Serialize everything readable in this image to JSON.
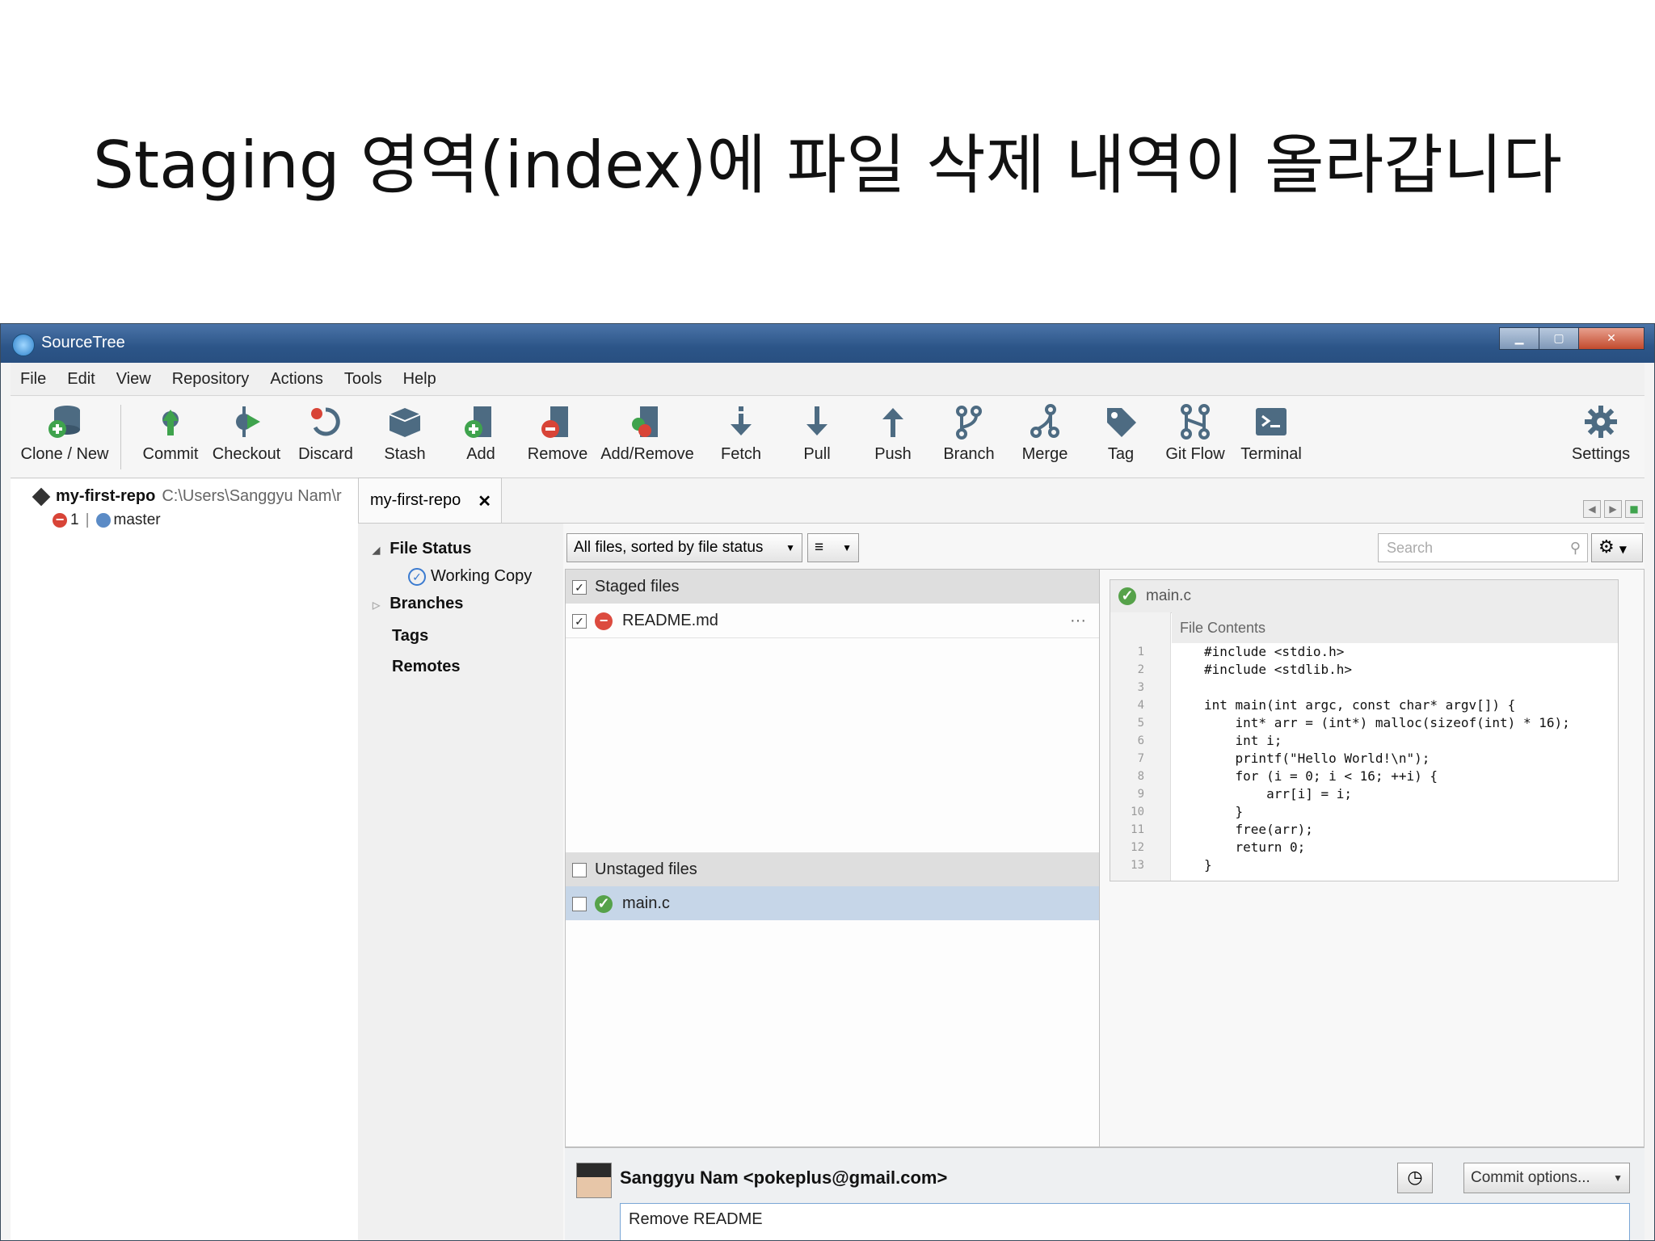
{
  "slide": {
    "title": "Staging 영역(index)에 파일 삭제 내역이 올라갑니다"
  },
  "window": {
    "title": "SourceTree",
    "controls": {
      "minimize": "▁",
      "maximize": "▢",
      "close": "✕"
    }
  },
  "menu": [
    "File",
    "Edit",
    "View",
    "Repository",
    "Actions",
    "Tools",
    "Help"
  ],
  "toolbar": {
    "clone_new": "Clone / New",
    "commit": "Commit",
    "checkout": "Checkout",
    "discard": "Discard",
    "stash": "Stash",
    "add": "Add",
    "remove": "Remove",
    "add_remove": "Add/Remove",
    "fetch": "Fetch",
    "pull": "Pull",
    "push": "Push",
    "branch": "Branch",
    "merge": "Merge",
    "tag": "Tag",
    "git_flow": "Git Flow",
    "terminal": "Terminal",
    "settings": "Settings"
  },
  "repo": {
    "name": "my-first-repo",
    "path": "C:\\Users\\Sanggyu Nam\\r",
    "pending_count": "1",
    "separator": "|",
    "branch": "master"
  },
  "tab": {
    "label": "my-first-repo",
    "close": "✕"
  },
  "nav": {
    "file_status": "File Status",
    "working_copy": "Working Copy",
    "branches": "Branches",
    "tags": "Tags",
    "remotes": "Remotes"
  },
  "filter": {
    "mode": "All files, sorted by file status",
    "view_mode": "≡",
    "search_placeholder": "Search"
  },
  "staged": {
    "header": "Staged files",
    "files": [
      {
        "name": "README.md",
        "status": "removed",
        "checked": true
      }
    ],
    "more": "···"
  },
  "unstaged": {
    "header": "Unstaged files",
    "files": [
      {
        "name": "main.c",
        "status": "clean",
        "checked": false
      }
    ]
  },
  "diff": {
    "file": "main.c",
    "subheader": "File Contents",
    "lines": [
      {
        "no": "1",
        "text": "#include <stdio.h>"
      },
      {
        "no": "2",
        "text": "#include <stdlib.h>"
      },
      {
        "no": "3",
        "text": ""
      },
      {
        "no": "4",
        "text": "int main(int argc, const char* argv[]) {"
      },
      {
        "no": "5",
        "text": "    int* arr = (int*) malloc(sizeof(int) * 16);"
      },
      {
        "no": "6",
        "text": "    int i;"
      },
      {
        "no": "7",
        "text": "    printf(\"Hello World!\\n\");"
      },
      {
        "no": "8",
        "text": "    for (i = 0; i < 16; ++i) {"
      },
      {
        "no": "9",
        "text": "        arr[i] = i;"
      },
      {
        "no": "10",
        "text": "    }"
      },
      {
        "no": "11",
        "text": "    free(arr);"
      },
      {
        "no": "12",
        "text": "    return 0;"
      },
      {
        "no": "13",
        "text": "}"
      }
    ]
  },
  "commit": {
    "author": "Sanggyu Nam <pokeplus@gmail.com>",
    "options": "Commit options...",
    "message": "Remove README"
  }
}
